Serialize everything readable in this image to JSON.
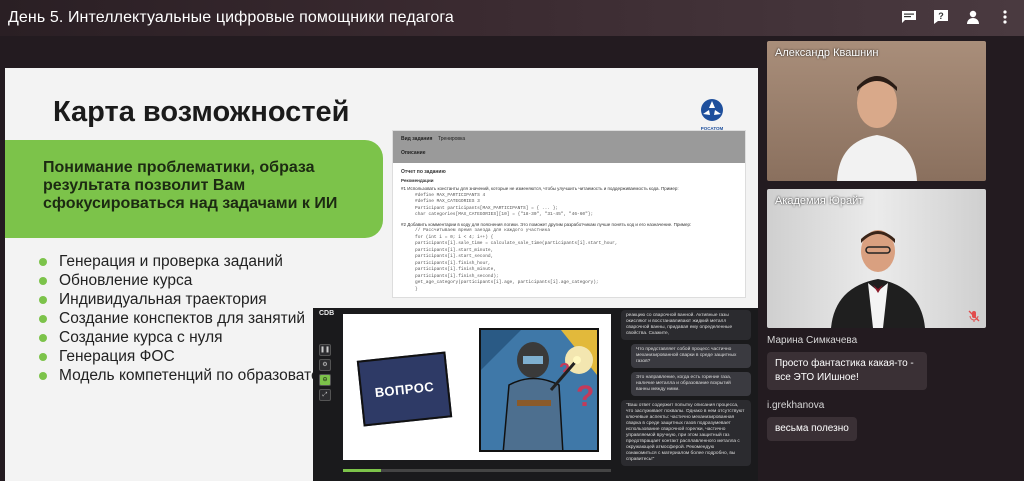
{
  "header": {
    "title": "День 5. Интеллектуальные цифровые помощники педагога"
  },
  "toolbar_icons": [
    "chat-icon",
    "help-icon",
    "person-icon",
    "more-vert-icon"
  ],
  "slide": {
    "title": "Карта возможностей",
    "logo_text": "РОСАТОМ",
    "green_text": "Понимание проблематики, образа результата позволит Вам сфокусироваться над задачами к ИИ",
    "bullets": [
      "Генерация и проверка заданий",
      "Обновление курса",
      "Индивидуальная траектория",
      "Создание конспектов для занятий",
      "Создание курса с нуля",
      "Генерация ФОС",
      "Модель компетенций по образовательной программе"
    ],
    "doc": {
      "field1_label": "Вид задания",
      "field1_value": "Тренировка",
      "field2_label": "Описание",
      "section": "Отчет по заданию",
      "sub": "Рекомендации",
      "item1": "#1  Использовать константы для значений, которые не изменяются, чтобы улучшить читаемость и поддерживаемость кода. Пример:",
      "code1": [
        "#define MAX_PARTICIPANTS 4",
        "#define MAX_CATEGORIES 3",
        "",
        "Participant participants[MAX_PARTICIPANTS] = { ... };",
        "char categories[MAX_CATEGORIES][10] = {\"18-30\", \"31-45\", \"46-60\"};"
      ],
      "item2": "#2  Добавить комментарии в коду для пояснения логики. Это поможет другим разработчикам лучше понять код и его назначение. Пример:",
      "code2": [
        "// Рассчитываем время заезда для каждого участника",
        "for (int i = 0; i < 4; i++) {",
        "    participants[i].sale_time = calculate_sale_time(participants[i].start_hour,",
        "                                                     participants[i].start_minute,",
        "                                                     participants[i].start_second,",
        "                                                     participants[i].finish_hour,",
        "                                                     participants[i].finish_minute,",
        "                                                     participants[i].finish_second);",
        "    get_age_category(participants[i].age, participants[i].age_category);",
        "}"
      ]
    },
    "screen": {
      "label": "CDB",
      "card_text": "ВОПРОС",
      "progress": 0.14,
      "messages": [
        {
          "kind": "answer",
          "text": "реакцию со сварочной ванной. Активные газы окисляют и восстанавливают жидкий металл сварочной ванны, придавая ему определенные свойства. Скажите,"
        },
        {
          "kind": "question",
          "text": "Что представляет собой процесс частично механизированной сварки в среде защитных газов?"
        },
        {
          "kind": "question",
          "text": "Это направление, когда есть горение газа, наличие металла и образование вскрытий ванны между ними."
        },
        {
          "kind": "answer",
          "text": "\"Ваш ответ содержит попытку описания процесса, что заслуживает похвалы. Однако в нем отсутствуют ключевые аспекты: частично механизированная сварка в среде защитных газов подразумевает использование сварочной горелки, частично управляемой вручную, при этом защитный газ предотвращает контакт расплавленного металла с окружающей атмосферой. Рекомендую ознакомиться с материалом более подробно, вы справитесь!\""
        }
      ]
    }
  },
  "participants": [
    {
      "name": "Александр Квашнин"
    },
    {
      "name": "Академия Юрайт"
    }
  ],
  "chat": [
    {
      "sender": "Марина Симкачева",
      "text": "Просто фантастика какая-то - все ЭТО ИИшное!"
    },
    {
      "sender": "i.grekhanova",
      "text": "весьма полезно"
    }
  ],
  "colors": {
    "accent_green": "#7cc34a",
    "bg": "#231b20"
  }
}
